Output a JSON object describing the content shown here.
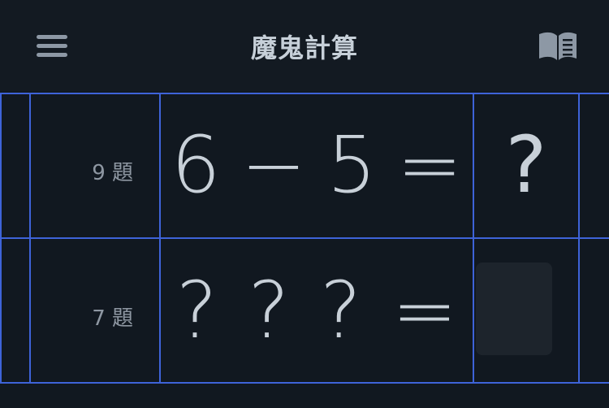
{
  "header": {
    "title": "魔鬼計算",
    "menu_icon": "menu-icon",
    "book_icon": "book-icon"
  },
  "questions": [
    {
      "number_label": "9 題",
      "operand1": "6",
      "operator": "−",
      "operand2": "5",
      "equals": "=",
      "answer": "?"
    },
    {
      "number_label": "7 題",
      "operand1": "?",
      "operator": "?",
      "operand2": "?",
      "equals": "=",
      "answer": ""
    }
  ],
  "colors": {
    "background": "#111820",
    "grid_line": "#3e63d8",
    "text": "#c8d0d8",
    "muted_text": "#8e97a2"
  }
}
